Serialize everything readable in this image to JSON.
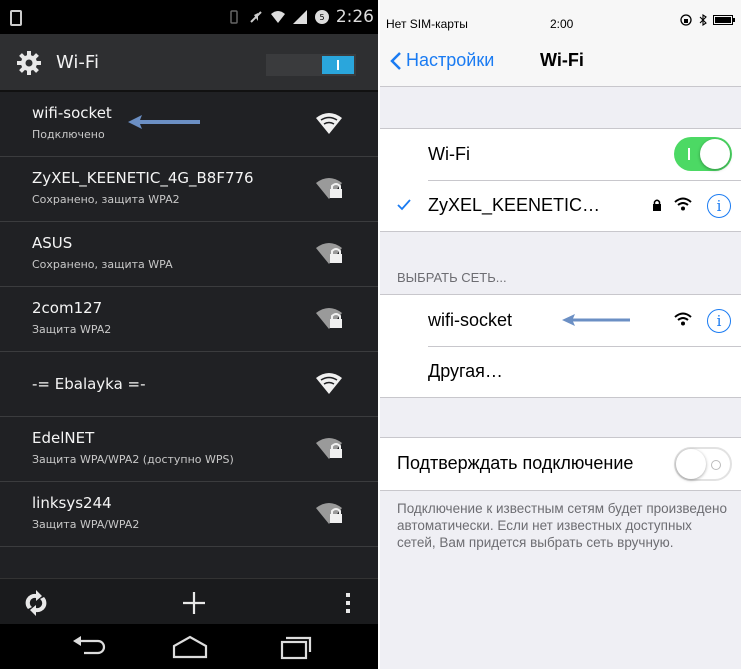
{
  "android": {
    "status_time": "2:26",
    "title": "Wi-Fi",
    "networks": [
      {
        "name": "wifi-socket",
        "sub": "Подключено",
        "locked": false
      },
      {
        "name": "ZyXEL_KEENETIC_4G_B8F776",
        "sub": "Сохранено, защита WPA2",
        "locked": true
      },
      {
        "name": "ASUS",
        "sub": "Сохранено, защита WPA",
        "locked": true
      },
      {
        "name": "2com127",
        "sub": "Защита WPA2",
        "locked": true
      },
      {
        "name": "-= Ebalayka =-",
        "sub": "",
        "locked": false
      },
      {
        "name": "EdelNET",
        "sub": "Защита WPA/WPA2 (доступно WPS)",
        "locked": true
      },
      {
        "name": "linksys244",
        "sub": "Защита WPA/WPA2",
        "locked": true
      }
    ]
  },
  "ios": {
    "status": {
      "carrier": "Нет SIM-карты",
      "time": "2:00"
    },
    "nav": {
      "back": "Настройки",
      "title": "Wi-Fi"
    },
    "wifi_label": "Wi-Fi",
    "connected_network": "ZyXEL_KEENETIC…",
    "choose_header": "ВЫБРАТЬ СЕТЬ...",
    "networks": [
      "wifi-socket",
      "Другая…"
    ],
    "ask_join_label": "Подтверждать подключение",
    "footer": "Подключение к известным сетям будет произведено автоматически. Если нет известных доступных сетей, Вам придется выбрать сеть вручную."
  },
  "colors": {
    "ios_blue": "#1a7bf2",
    "ios_green": "#4cd964",
    "android_accent": "#2aa6dc",
    "arrow": "#6b8fc4"
  }
}
